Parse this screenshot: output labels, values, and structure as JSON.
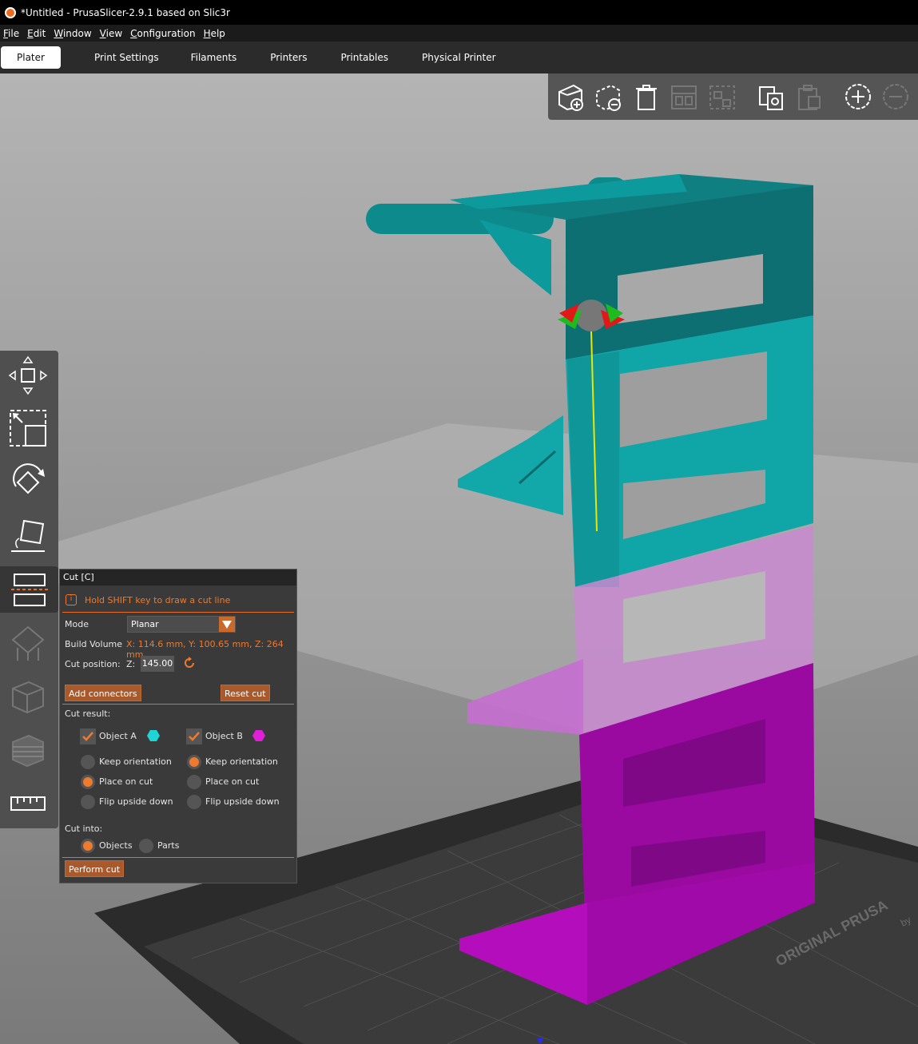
{
  "window": {
    "title": "*Untitled - PrusaSlicer-2.9.1 based on Slic3r"
  },
  "menu": [
    "File",
    "Edit",
    "Window",
    "View",
    "Configuration",
    "Help"
  ],
  "tabs": [
    {
      "label": "Plater",
      "active": true
    },
    {
      "label": "Print Settings"
    },
    {
      "label": "Filaments"
    },
    {
      "label": "Printers"
    },
    {
      "label": "Printables"
    },
    {
      "label": "Physical Printer"
    }
  ],
  "top_toolbar": [
    "add-object-icon",
    "delete-icon",
    "delete-all-icon",
    "arrange-icon",
    "arrange-selection-icon",
    "copy-icon",
    "paste-icon",
    "add-instance-icon",
    "remove-instance-icon"
  ],
  "left_toolbar": [
    "move-icon",
    "scale-icon",
    "rotate-icon",
    "place-on-face-icon",
    "cut-icon",
    "supports-icon",
    "seam-icon",
    "mmu-segmentation-icon",
    "measure-icon"
  ],
  "bed_text": "ORIGINAL PRUSA",
  "bed_text2": "by",
  "cut_panel": {
    "title": "Cut [C]",
    "hint": "Hold SHIFT key to draw a cut line",
    "mode_label": "Mode",
    "mode_value": "Planar",
    "build_volume_label": "Build Volume",
    "build_volume_value": "X: 114.6 mm,  Y: 100.65 mm,  Z: 264 mm",
    "cut_position_label": "Cut position:",
    "axis_label": "Z:",
    "cut_position_value": "145.00",
    "add_connectors": "Add connectors",
    "reset_cut": "Reset cut",
    "cut_result_label": "Cut result:",
    "object_a": "Object A",
    "object_b": "Object B",
    "object_a_color": "#1fd5d5",
    "object_b_color": "#e01fd8",
    "keep_orientation": "Keep orientation",
    "place_on_cut": "Place on cut",
    "flip_upside_down": "Flip upside down",
    "cut_into_label": "Cut into:",
    "objects": "Objects",
    "parts": "Parts",
    "perform_cut": "Perform cut"
  },
  "colors": {
    "accent": "#ed6b21",
    "part_upper": "#0f9fa0",
    "part_lower": "#a010a8"
  }
}
